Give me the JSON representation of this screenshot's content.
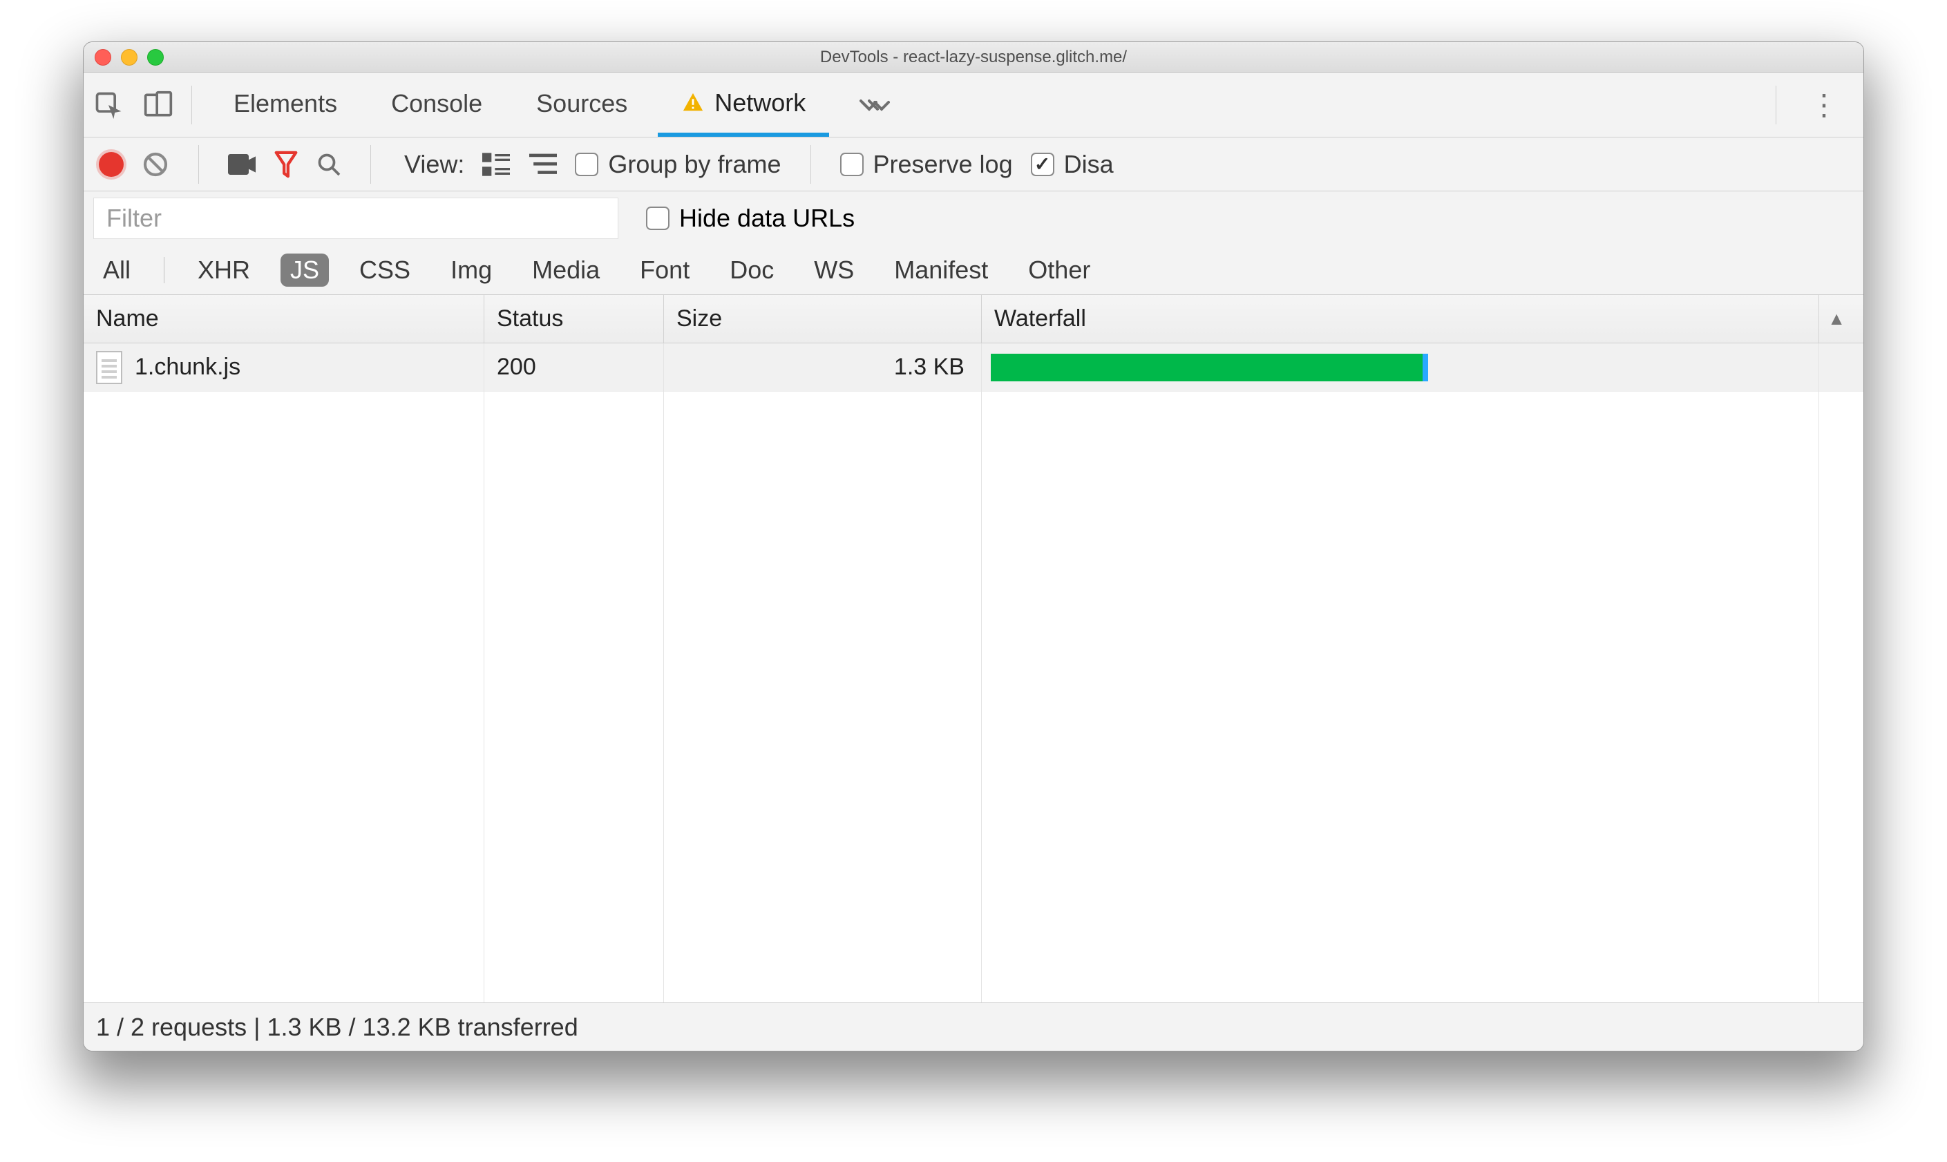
{
  "window": {
    "title": "DevTools - react-lazy-suspense.glitch.me/"
  },
  "tabs": {
    "items": [
      "Elements",
      "Console",
      "Sources",
      "Network"
    ],
    "active": "Network",
    "warning_on": "Network"
  },
  "toolbar": {
    "view_label": "View:",
    "group_by_frame": {
      "label": "Group by frame",
      "checked": false
    },
    "preserve_log": {
      "label": "Preserve log",
      "checked": false
    },
    "disable_cache": {
      "label": "Disa",
      "checked": true
    }
  },
  "filter": {
    "placeholder": "Filter",
    "hide_data_urls": {
      "label": "Hide data URLs",
      "checked": false
    }
  },
  "resource_types": {
    "items": [
      "All",
      "XHR",
      "JS",
      "CSS",
      "Img",
      "Media",
      "Font",
      "Doc",
      "WS",
      "Manifest",
      "Other"
    ],
    "active": "JS"
  },
  "columns": {
    "name": "Name",
    "status": "Status",
    "size": "Size",
    "waterfall": "Waterfall"
  },
  "rows": [
    {
      "name": "1.chunk.js",
      "status": "200",
      "size": "1.3 KB",
      "waterfall": {
        "start_pct": 1,
        "width_pct": 49
      }
    }
  ],
  "status": {
    "text": "1 / 2 requests | 1.3 KB / 13.2 KB transferred"
  }
}
